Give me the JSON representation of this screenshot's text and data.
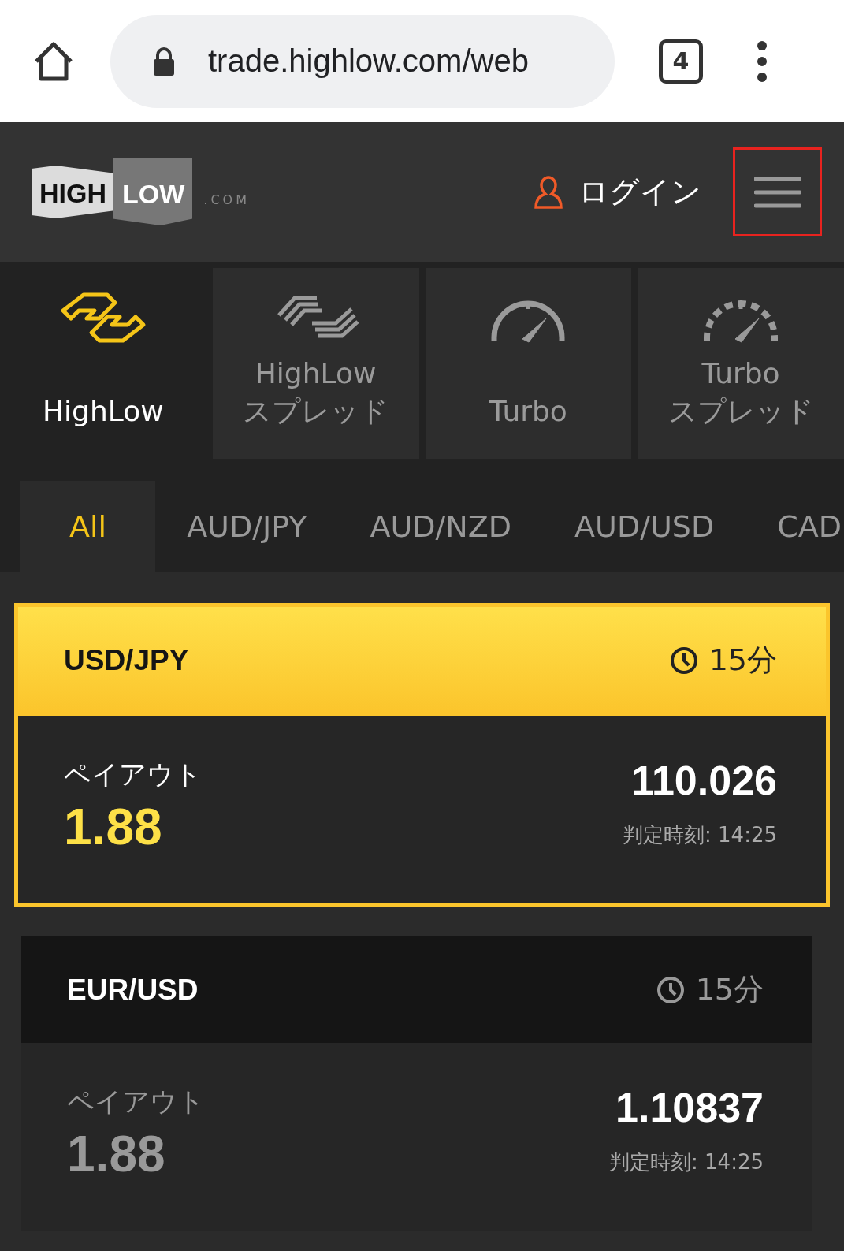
{
  "browser": {
    "url": "trade.highlow.com/web",
    "tab_count": "4"
  },
  "header": {
    "logo": {
      "high": "HIGH",
      "low": "LOW",
      "suffix": ".COM"
    },
    "login": "ログイン",
    "menu_button": {
      "highlighted": true
    }
  },
  "products": [
    {
      "label": "HighLow",
      "selected": true
    },
    {
      "label": "HighLow\nスプレッド",
      "selected": false
    },
    {
      "label": "Turbo",
      "selected": false
    },
    {
      "label": "Turbo\nスプレッド",
      "selected": false
    }
  ],
  "assets": [
    {
      "label": "All",
      "selected": true
    },
    {
      "label": "AUD/JPY",
      "selected": false
    },
    {
      "label": "AUD/NZD",
      "selected": false
    },
    {
      "label": "AUD/USD",
      "selected": false
    },
    {
      "label": "CAD",
      "selected": false
    }
  ],
  "cards": [
    {
      "pair": "USD/JPY",
      "duration": "15分",
      "payout_label": "ペイアウト",
      "payout": "1.88",
      "rate": "110.026",
      "close_time": "判定時刻: 14:25",
      "selected": true
    },
    {
      "pair": "EUR/USD",
      "duration": "15分",
      "payout_label": "ペイアウト",
      "payout": "1.88",
      "rate": "1.10837",
      "close_time": "判定時刻: 14:25",
      "selected": false
    }
  ]
}
